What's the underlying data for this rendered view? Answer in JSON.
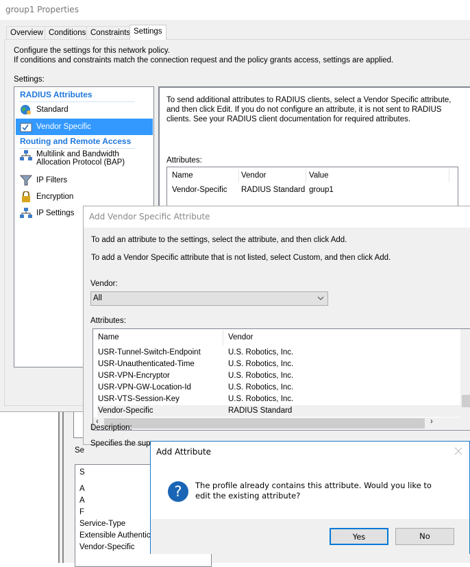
{
  "main_window": {
    "title": "group1 Properties",
    "tabs": [
      "Overview",
      "Conditions",
      "Constraints",
      "Settings"
    ],
    "intro_line1": "Configure the settings for this network policy.",
    "intro_line2": "If conditions and constraints match the connection request and the policy grants access, settings are applied.",
    "settings_label": "Settings:",
    "groups": {
      "radius": "RADIUS Attributes",
      "routing": "Routing and Remote Access"
    },
    "items": {
      "standard": "Standard",
      "vendor_specific": "Vendor Specific",
      "multilink1": "Multilink and Bandwidth",
      "multilink2": "Allocation Protocol (BAP)",
      "ip_filters": "IP Filters",
      "encryption": "Encryption",
      "ip_settings": "IP Settings"
    },
    "panel_text": "To send additional attributes to RADIUS clients, select a Vendor Specific attribute, and then click Edit. If you do not configure an attribute, it is not sent to RADIUS clients. See your RADIUS client documentation for required attributes.",
    "attributes_label": "Attributes:",
    "columns": [
      "Name",
      "Vendor",
      "Value"
    ],
    "rows": [
      {
        "name": "Vendor-Specific",
        "vendor": "RADIUS Standard",
        "value": "group1"
      }
    ]
  },
  "behind_window": {
    "label_partial": "Se",
    "list_items": [
      "S",
      "A",
      "A",
      "F",
      "Service-Type",
      "Extensible Authentica",
      "Vendor-Specific"
    ]
  },
  "vendor_dialog": {
    "title": "Add Vendor Specific Attribute",
    "line1": "To add an attribute to the settings, select the attribute, and then click Add.",
    "line2": "To add a Vendor Specific attribute that is not listed, select Custom, and then click Add.",
    "vendor_label": "Vendor:",
    "vendor_value": "All",
    "attributes_label": "Attributes:",
    "columns": [
      "Name",
      "Vendor"
    ],
    "rows": [
      {
        "name": "USR-Tunnel-Switch-Endpoint",
        "vendor": "U.S. Robotics, Inc."
      },
      {
        "name": "USR-Unauthenticated-Time",
        "vendor": "U.S. Robotics, Inc."
      },
      {
        "name": "USR-VPN-Encryptor",
        "vendor": "U.S. Robotics, Inc."
      },
      {
        "name": "USR-VPN-GW-Location-Id",
        "vendor": "U.S. Robotics, Inc."
      },
      {
        "name": "USR-VTS-Session-Key",
        "vendor": "U.S. Robotics, Inc."
      },
      {
        "name": "Vendor-Specific",
        "vendor": "RADIUS Standard"
      }
    ],
    "description_label": "Description:",
    "description_partial": "Specifies the supp"
  },
  "message_box": {
    "title": "Add Attribute",
    "message": "The profile already contains this attribute. Would you like to edit the existing attribute?",
    "yes": "Yes",
    "no": "No",
    "accent": "#1979ca"
  }
}
